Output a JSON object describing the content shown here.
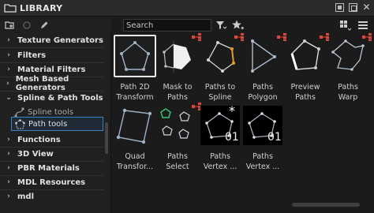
{
  "window": {
    "title": "LIBRARY"
  },
  "search": {
    "placeholder": "Search"
  },
  "sidebar": {
    "groups": [
      {
        "label": "Texture Generators",
        "caret": "›"
      },
      {
        "label": "Filters",
        "caret": "›"
      },
      {
        "label": "Material Filters",
        "caret": "›"
      },
      {
        "label": "Mesh Based Generators",
        "caret": "›"
      },
      {
        "label": "Spline & Path Tools",
        "caret": "⌄"
      },
      {
        "label": "Functions",
        "caret": "›"
      },
      {
        "label": "3D View",
        "caret": "›"
      },
      {
        "label": "PBR Materials",
        "caret": "›"
      },
      {
        "label": "MDL Resources",
        "caret": "›"
      },
      {
        "label": "mdl",
        "caret": "›"
      }
    ],
    "children": [
      {
        "label": "Spline tools"
      },
      {
        "label": "Path tools"
      }
    ]
  },
  "library_items": [
    {
      "line1": "Path 2D",
      "line2": "Transform"
    },
    {
      "line1": "Mask to",
      "line2": "Paths"
    },
    {
      "line1": "Paths to",
      "line2": "Spline"
    },
    {
      "line1": "Paths",
      "line2": "Polygon"
    },
    {
      "line1": "Preview",
      "line2": "Paths"
    },
    {
      "line1": "Paths",
      "line2": "Warp"
    },
    {
      "line1": "Quad",
      "line2": "Transfor..."
    },
    {
      "line1": "Paths",
      "line2": "Select"
    },
    {
      "line1": "Paths",
      "line2": "Vertex ..."
    },
    {
      "line1": "Paths",
      "line2": "Vertex ..."
    }
  ],
  "thumb_counters": {
    "vertex_a": "01",
    "vertex_b": "01"
  },
  "colors": {
    "accent": "#3b82c4",
    "badge": "#e0453a",
    "spline": "#e69b25",
    "select": "#3ec27a"
  }
}
